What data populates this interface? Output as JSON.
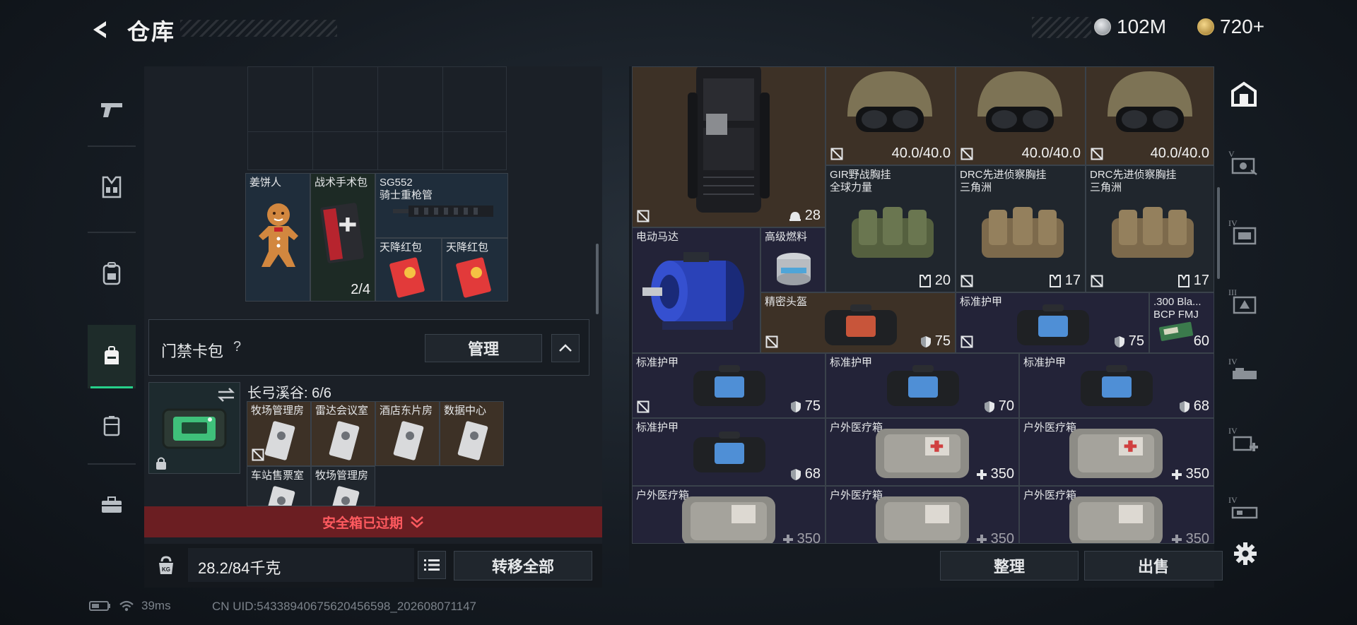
{
  "header": {
    "title": "仓库",
    "currencies": [
      {
        "type": "silver",
        "amount": "102M"
      },
      {
        "type": "gold",
        "amount": "720+"
      }
    ]
  },
  "left_rail": {
    "items": [
      {
        "id": "weapons",
        "icon": "pistol-icon",
        "active": false
      },
      {
        "id": "chest-rig",
        "icon": "chest-rig-icon",
        "active": false
      },
      {
        "id": "backpack",
        "icon": "backpack-icon",
        "active": false
      },
      {
        "id": "bag",
        "icon": "bag-icon",
        "active": true
      },
      {
        "id": "container",
        "icon": "container-icon",
        "active": false
      },
      {
        "id": "toolbox",
        "icon": "toolbox-icon",
        "active": false
      }
    ]
  },
  "loadout_items": [
    {
      "label": "姜饼人",
      "value": "",
      "bg": "blue"
    },
    {
      "label": "战术手术包",
      "value": "2/4",
      "bg": "green"
    },
    {
      "label": "SG552\n骑士重枪管",
      "value": "",
      "bg": "blue"
    },
    {
      "label": "天降红包",
      "value": "",
      "bg": "blue"
    },
    {
      "label": "天降红包",
      "value": "",
      "bg": "blue"
    }
  ],
  "keycard": {
    "title": "门禁卡包",
    "help": "?",
    "manage_label": "管理",
    "region_label": "长弓溪谷: 6/6",
    "cards": [
      {
        "label": "牧场管理房",
        "bg": "brown"
      },
      {
        "label": "雷达会议室",
        "bg": "brown"
      },
      {
        "label": "酒店东片房",
        "bg": "brown"
      },
      {
        "label": "数据中心",
        "bg": "brown"
      },
      {
        "label": "车站售票室",
        "bg": "dark"
      },
      {
        "label": "牧场管理房",
        "bg": "dark"
      }
    ]
  },
  "safe_box": {
    "expired_label": "安全箱已过期"
  },
  "bottom_left": {
    "weight": "28.2/84千克",
    "transfer_label": "转移全部"
  },
  "storage_items": [
    {
      "label": "",
      "value": "28",
      "stat_icon": "helmet-stat-icon",
      "bg": "brown",
      "no_insure": true
    },
    {
      "label": "",
      "value": "40.0/40.0",
      "stat_icon": "",
      "bg": "brown",
      "no_insure": true
    },
    {
      "label": "",
      "value": "40.0/40.0",
      "stat_icon": "",
      "bg": "brown",
      "no_insure": true
    },
    {
      "label": "",
      "value": "40.0/40.0",
      "stat_icon": "",
      "bg": "brown",
      "no_insure": true
    },
    {
      "label": "GIR野战胸挂\n全球力量",
      "value": "20",
      "stat_icon": "rig-stat-icon",
      "bg": "dark",
      "no_insure": false
    },
    {
      "label": "DRC先进侦察胸挂\n三角洲",
      "value": "17",
      "stat_icon": "rig-stat-icon",
      "bg": "dark",
      "no_insure": true
    },
    {
      "label": "DRC先进侦察胸挂\n三角洲",
      "value": "17",
      "stat_icon": "rig-stat-icon",
      "bg": "dark",
      "no_insure": true
    },
    {
      "label": "电动马达",
      "value": "",
      "stat_icon": "",
      "bg": "purple",
      "no_insure": false
    },
    {
      "label": "高级燃料",
      "value": "",
      "stat_icon": "",
      "bg": "purple",
      "no_insure": false
    },
    {
      "label": "精密头盔",
      "value": "75",
      "stat_icon": "armor-stat-icon",
      "bg": "brown",
      "no_insure": true
    },
    {
      "label": "标准护甲",
      "value": "75",
      "stat_icon": "armor-stat-icon",
      "bg": "purple",
      "no_insure": true
    },
    {
      "label": ".300 Bla...\nBCP FMJ",
      "value": "60",
      "stat_icon": "",
      "bg": "purple",
      "no_insure": false
    },
    {
      "label": "标准护甲",
      "value": "75",
      "stat_icon": "armor-stat-icon",
      "bg": "purple",
      "no_insure": true
    },
    {
      "label": "标准护甲",
      "value": "70",
      "stat_icon": "armor-stat-icon",
      "bg": "purple",
      "no_insure": false
    },
    {
      "label": "标准护甲",
      "value": "68",
      "stat_icon": "armor-stat-icon",
      "bg": "purple",
      "no_insure": false
    },
    {
      "label": "标准护甲",
      "value": "68",
      "stat_icon": "armor-stat-icon",
      "bg": "purple",
      "no_insure": false
    },
    {
      "label": "户外医疗箱",
      "value": "350",
      "stat_icon": "heal-stat-icon",
      "bg": "purple",
      "no_insure": false
    },
    {
      "label": "户外医疗箱",
      "value": "350",
      "stat_icon": "heal-stat-icon",
      "bg": "purple",
      "no_insure": false
    },
    {
      "label": "户外医疗箱",
      "value": "350",
      "stat_icon": "heal-stat-icon",
      "bg": "purple",
      "no_insure": false
    },
    {
      "label": "户外医疗箱",
      "value": "350",
      "stat_icon": "heal-stat-icon",
      "bg": "purple",
      "no_insure": false
    },
    {
      "label": "户外医疗箱",
      "value": "350",
      "stat_icon": "heal-stat-icon",
      "bg": "purple",
      "no_insure": false
    }
  ],
  "bottom_right": {
    "organize_label": "整理",
    "sell_label": "出售"
  },
  "right_rail": {
    "items": [
      {
        "id": "all",
        "icon": "warehouse-icon",
        "tier": ""
      },
      {
        "id": "v-1",
        "icon": "storage-tier-icon",
        "tier": "V"
      },
      {
        "id": "iv-1",
        "icon": "storage-tier-icon",
        "tier": "IV"
      },
      {
        "id": "iii-1",
        "icon": "storage-tier-icon",
        "tier": "III"
      },
      {
        "id": "iv-2",
        "icon": "storage-tier-icon",
        "tier": "IV"
      },
      {
        "id": "iv-3",
        "icon": "storage-tier-icon",
        "tier": "IV"
      },
      {
        "id": "iv-4",
        "icon": "storage-tier-icon",
        "tier": "IV"
      }
    ]
  },
  "footer": {
    "ping": "39ms",
    "uid": "CN UID:5433894067562045659​8_202608071147"
  },
  "colors": {
    "accent": "#27d08a",
    "expired": "#ff5a5f",
    "expired_bg": "#6b1e22"
  }
}
